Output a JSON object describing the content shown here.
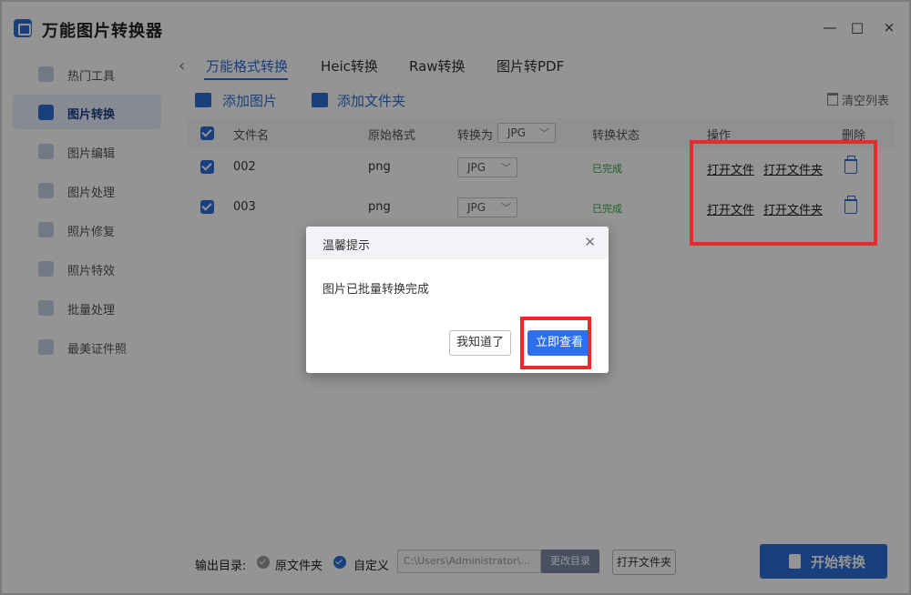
{
  "window": {
    "title": "万能图片转换器",
    "controls": [
      "—",
      "□",
      "×"
    ]
  },
  "sidebar": {
    "items": [
      {
        "label": "热门工具",
        "icon": "fire-icon"
      },
      {
        "label": "图片转换",
        "icon": "image-convert-icon",
        "active": true
      },
      {
        "label": "图片编辑",
        "icon": "image-edit-icon"
      },
      {
        "label": "图片处理",
        "icon": "image-process-icon"
      },
      {
        "label": "照片修复",
        "icon": "photo-repair-icon"
      },
      {
        "label": "照片特效",
        "icon": "photo-effects-icon"
      },
      {
        "label": "批量处理",
        "icon": "batch-icon"
      },
      {
        "label": "最美证件照",
        "icon": "id-photo-icon"
      }
    ]
  },
  "tabs": [
    {
      "label": "万能格式转换",
      "active": true
    },
    {
      "label": "Heic转换"
    },
    {
      "label": "Raw转换"
    },
    {
      "label": "图片转PDF"
    }
  ],
  "toolbar": {
    "add_image": "添加图片",
    "add_folder": "添加文件夹",
    "clear_list": "清空列表"
  },
  "table": {
    "headers": {
      "filename": "文件名",
      "original_format": "原始格式",
      "convert_to": "转换为",
      "convert_to_value": "JPG",
      "status": "转换状态",
      "actions": "操作",
      "delete": "删除"
    },
    "rows": [
      {
        "filename": "002",
        "format": "png",
        "target": "JPG",
        "status": "已完成",
        "open_file": "打开文件",
        "open_folder": "打开文件夹"
      },
      {
        "filename": "003",
        "format": "png",
        "target": "JPG",
        "status": "已完成",
        "open_file": "打开文件",
        "open_folder": "打开文件夹"
      }
    ]
  },
  "dialog": {
    "title": "温馨提示",
    "message": "图片已批量转换完成",
    "secondary_button": "我知道了",
    "primary_button": "立即查看"
  },
  "bottom": {
    "output_label": "输出目录:",
    "option_original": "原文件夹",
    "option_custom": "自定义",
    "path_value": "C:\\Users\\Administrator\\...",
    "change_dir": "更改目录",
    "open_folder": "打开文件夹",
    "start": "开始转换"
  },
  "colors": {
    "accent": "#2b6fd8",
    "primary_button": "#2e6ff0",
    "highlight_box": "#e82a2a",
    "status_done": "#3aa24a"
  }
}
